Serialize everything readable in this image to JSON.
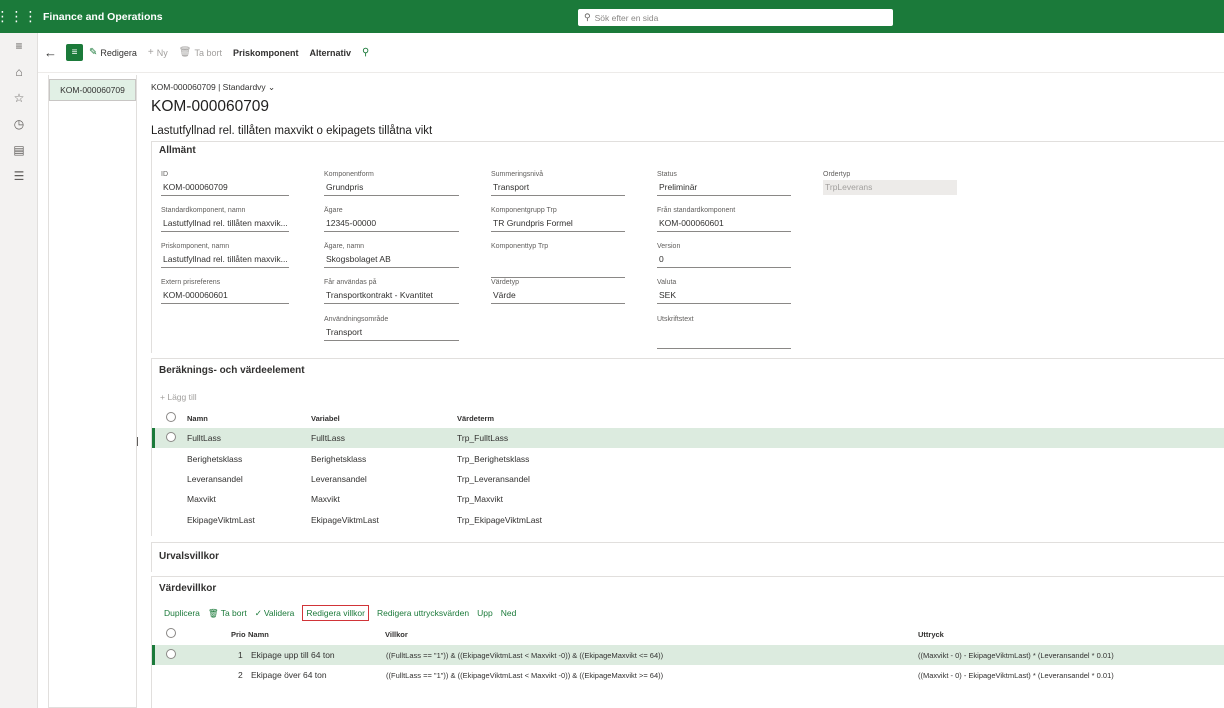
{
  "app": {
    "name": "Finance and Operations",
    "search_placeholder": "Sök efter en sida"
  },
  "actionbar": {
    "edit": "Redigera",
    "new": "Ny",
    "delete": "Ta bort",
    "price_component": "Priskomponent",
    "options": "Alternativ"
  },
  "list": {
    "selected": "KOM-000060709"
  },
  "header": {
    "breadcrumb": "KOM-000060709  |  Standardvy",
    "title": "KOM-000060709",
    "description": "Lastutfyllnad rel. tillåten maxvikt o ekipagets tillåtna vikt"
  },
  "general": {
    "title": "Allmänt",
    "fields": {
      "id": {
        "label": "ID",
        "value": "KOM-000060709"
      },
      "std_name": {
        "label": "Standardkomponent, namn",
        "value": "Lastutfyllnad rel. tillåten maxvik..."
      },
      "pc_name": {
        "label": "Priskomponent, namn",
        "value": "Lastutfyllnad rel. tillåten maxvik..."
      },
      "ext_ref": {
        "label": "Extern prisreferens",
        "value": "KOM-000060601"
      },
      "comp_form": {
        "label": "Komponentform",
        "value": "Grundpris"
      },
      "owner": {
        "label": "Ägare",
        "value": "12345-00000"
      },
      "owner_name": {
        "label": "Ägare, namn",
        "value": "Skogsbolaget AB"
      },
      "used_on": {
        "label": "Får användas på",
        "value": "Transportkontrakt - Kvantitet"
      },
      "usage_area": {
        "label": "Användningsområde",
        "value": "Transport"
      },
      "sum_level": {
        "label": "Summeringsnivå",
        "value": "Transport"
      },
      "comp_group": {
        "label": "Komponentgrupp Trp",
        "value": "TR Grundpris Formel"
      },
      "comp_type": {
        "label": "Komponenttyp Trp",
        "value": ""
      },
      "value_type": {
        "label": "Värdetyp",
        "value": "Värde"
      },
      "status": {
        "label": "Status",
        "value": "Preliminär"
      },
      "from_std": {
        "label": "Från standardkomponent",
        "value": "KOM-000060601"
      },
      "version": {
        "label": "Version",
        "value": "0"
      },
      "currency": {
        "label": "Valuta",
        "value": "SEK"
      },
      "print_text": {
        "label": "Utskriftstext",
        "value": ""
      },
      "order_type": {
        "label": "Ordertyp",
        "value": "TrpLeverans"
      }
    }
  },
  "calc": {
    "title": "Beräknings- och värdeelement",
    "add": "Lägg till",
    "columns": {
      "name": "Namn",
      "variable": "Variabel",
      "value_term": "Värdeterm"
    },
    "rows": [
      {
        "name": "FulltLass",
        "variable": "FulltLass",
        "term": "Trp_FulltLass"
      },
      {
        "name": "Berighetsklass",
        "variable": "Berighetsklass",
        "term": "Trp_Berighetsklass"
      },
      {
        "name": "Leveransandel",
        "variable": "Leveransandel",
        "term": "Trp_Leveransandel"
      },
      {
        "name": "Maxvikt",
        "variable": "Maxvikt",
        "term": "Trp_Maxvikt"
      },
      {
        "name": "EkipageViktmLast",
        "variable": "EkipageViktmLast",
        "term": "Trp_EkipageViktmLast"
      }
    ]
  },
  "selection": {
    "title": "Urvalsvillkor"
  },
  "valuecond": {
    "title": "Värdevillkor",
    "toolbar": {
      "duplicate": "Duplicera",
      "delete": "Ta bort",
      "validate": "Validera",
      "edit_conditions": "Redigera villkor",
      "edit_expr": "Redigera uttrycksvärden",
      "up": "Upp",
      "down": "Ned"
    },
    "columns": {
      "prio": "Prio",
      "name": "Namn",
      "conditions": "Villkor",
      "expression": "Uttryck"
    },
    "rows": [
      {
        "prio": "1",
        "name": "Ekipage upp till 64 ton",
        "cond": "((FulltLass == \"1\")) & ((EkipageViktmLast < Maxvikt -0)) & ((EkipageMaxvikt <= 64))",
        "expr": "((Maxvikt - 0) - EkipageViktmLast) * (Leveransandel * 0.01)"
      },
      {
        "prio": "2",
        "name": "Ekipage över 64 ton",
        "cond": "((FulltLass == \"1\")) & ((EkipageViktmLast < Maxvikt -0)) & ((EkipageMaxvikt >= 64))",
        "expr": "((Maxvikt - 0) - EkipageViktmLast) * (Leveransandel * 0.01)"
      }
    ]
  }
}
